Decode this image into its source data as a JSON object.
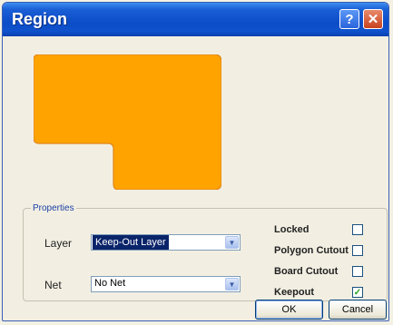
{
  "window": {
    "title": "Region"
  },
  "colors": {
    "region_fill": "#ffa300",
    "titlebar": "#0b4cc8",
    "check": "#21a121"
  },
  "icons": {
    "help": "help-icon",
    "close": "close-icon",
    "dropdown": "chevron-down-icon",
    "check": "check-icon"
  },
  "titlebar": {
    "help_glyph": "?",
    "close_glyph": "✕"
  },
  "properties": {
    "legend": "Properties",
    "layer": {
      "label": "Layer",
      "value": "Keep-Out Layer"
    },
    "net": {
      "label": "Net",
      "value": "No Net"
    },
    "checkboxes": [
      {
        "label": "Locked",
        "checked": false
      },
      {
        "label": "Polygon Cutout",
        "checked": false
      },
      {
        "label": "Board Cutout",
        "checked": false
      },
      {
        "label": "Keepout",
        "checked": true
      }
    ]
  },
  "buttons": {
    "ok": "OK",
    "cancel": "Cancel"
  }
}
